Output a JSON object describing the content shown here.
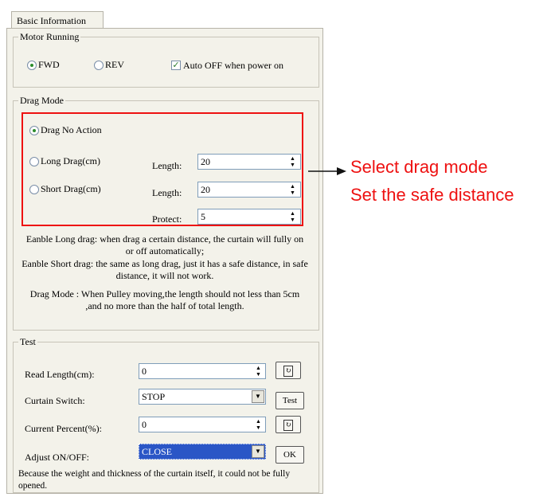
{
  "tab": {
    "label": "Basic Information"
  },
  "motor": {
    "legend": "Motor Running",
    "fwd": "FWD",
    "rev": "REV",
    "auto_off": "Auto OFF when power on"
  },
  "drag": {
    "legend": "Drag Mode",
    "no_action": "Drag No Action",
    "long": "Long Drag(cm)",
    "short": "Short Drag(cm)",
    "length_label": "Length:",
    "long_length": "20",
    "short_length": "20",
    "protect_label": "Protect:",
    "protect": "5",
    "desc1": "Eanble Long drag: when drag a certain distance, the curtain will fully on or off automatically;",
    "desc2": "Eanble Short drag: the same as long drag, just it has a safe distance, in safe distance, it will not work.",
    "desc3": "Drag Mode : When Pulley moving,the length should not less than 5cm ,and no more than the half of total length."
  },
  "test": {
    "legend": "Test",
    "read_length_label": "Read Length(cm):",
    "read_length": "0",
    "curtain_switch_label": "Curtain Switch:",
    "curtain_switch": "STOP",
    "test_button": "Test",
    "current_percent_label": "Current Percent(%):",
    "current_percent": "0",
    "adjust_label": "Adjust ON/OFF:",
    "adjust": "CLOSE",
    "ok_button": "OK",
    "note": "Because the weight and thickness of the curtain itself, it could not be fully opened."
  },
  "annotation": {
    "line1": "Select drag mode",
    "line2": "Set the safe distance"
  },
  "colors": {
    "annotation": "#ee1111",
    "selection": "#2a56c6"
  }
}
